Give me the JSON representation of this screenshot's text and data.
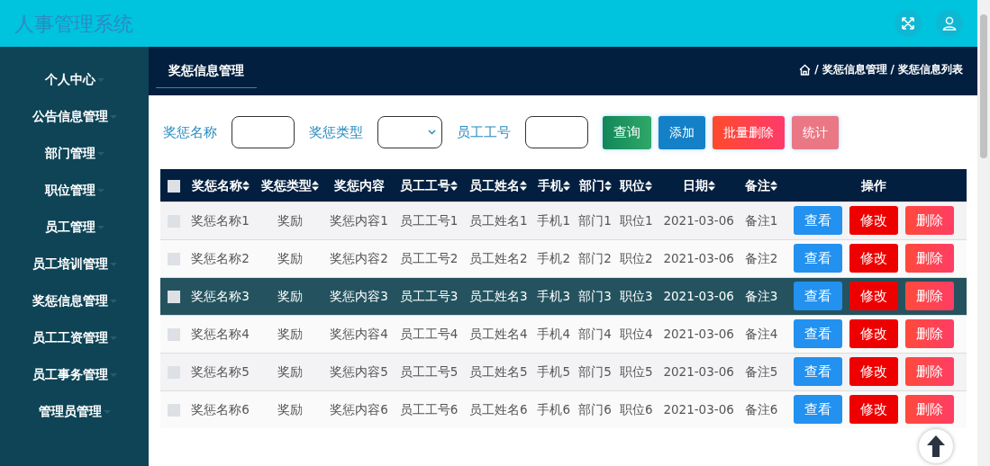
{
  "header": {
    "title": "人事管理系统"
  },
  "sidebar": {
    "items": [
      {
        "label": "个人中心"
      },
      {
        "label": "公告信息管理"
      },
      {
        "label": "部门管理"
      },
      {
        "label": "职位管理"
      },
      {
        "label": "员工管理"
      },
      {
        "label": "员工培训管理"
      },
      {
        "label": "奖惩信息管理"
      },
      {
        "label": "员工工资管理"
      },
      {
        "label": "员工事务管理"
      },
      {
        "label": "管理员管理"
      }
    ]
  },
  "page_tab": "奖惩信息管理",
  "breadcrumb": [
    {
      "separator": "/",
      "label": "奖惩信息管理"
    },
    {
      "separator": "/",
      "label": "奖惩信息列表"
    }
  ],
  "filters": [
    {
      "kind": "text",
      "label": "奖惩名称"
    },
    {
      "kind": "select",
      "label": "奖惩类型"
    },
    {
      "kind": "text",
      "label": "员工工号"
    }
  ],
  "actions": [
    {
      "kind": "search",
      "label": "查询"
    },
    {
      "kind": "add",
      "label": "添加"
    },
    {
      "kind": "delete",
      "label": "批量删除"
    },
    {
      "kind": "stats",
      "label": "统计"
    }
  ],
  "table": {
    "select_all": {
      "checked": false
    },
    "columns": [
      {
        "label": "奖惩名称",
        "sortable": true
      },
      {
        "label": "奖惩类型",
        "sortable": true
      },
      {
        "label": "奖惩内容",
        "sortable": false
      },
      {
        "label": "员工工号",
        "sortable": true
      },
      {
        "label": "员工姓名",
        "sortable": true
      },
      {
        "label": "手机",
        "sortable": true
      },
      {
        "label": "部门",
        "sortable": true
      },
      {
        "label": "职位",
        "sortable": true
      },
      {
        "label": "日期",
        "sortable": true
      },
      {
        "label": "备注",
        "sortable": true
      },
      {
        "label": "操作",
        "sortable": false
      }
    ],
    "rows": [
      {
        "selected": false,
        "checked": false,
        "cells": [
          "奖惩名称1",
          "奖励",
          "奖惩内容1",
          "员工工号1",
          "员工姓名1",
          "手机1",
          "部门1",
          "职位1",
          "2021-03-06",
          "备注1"
        ],
        "actions": [
          "查看",
          "修改",
          "删除"
        ]
      },
      {
        "selected": false,
        "checked": false,
        "cells": [
          "奖惩名称2",
          "奖励",
          "奖惩内容2",
          "员工工号2",
          "员工姓名2",
          "手机2",
          "部门2",
          "职位2",
          "2021-03-06",
          "备注2"
        ],
        "actions": [
          "查看",
          "修改",
          "删除"
        ]
      },
      {
        "selected": true,
        "checked": false,
        "cells": [
          "奖惩名称3",
          "奖励",
          "奖惩内容3",
          "员工工号3",
          "员工姓名3",
          "手机3",
          "部门3",
          "职位3",
          "2021-03-06",
          "备注3"
        ],
        "actions": [
          "查看",
          "修改",
          "删除"
        ]
      },
      {
        "selected": false,
        "checked": false,
        "cells": [
          "奖惩名称4",
          "奖励",
          "奖惩内容4",
          "员工工号4",
          "员工姓名4",
          "手机4",
          "部门4",
          "职位4",
          "2021-03-06",
          "备注4"
        ],
        "actions": [
          "查看",
          "修改",
          "删除"
        ]
      },
      {
        "selected": false,
        "checked": false,
        "cells": [
          "奖惩名称5",
          "奖励",
          "奖惩内容5",
          "员工工号5",
          "员工姓名5",
          "手机5",
          "部门5",
          "职位5",
          "2021-03-06",
          "备注5"
        ],
        "actions": [
          "查看",
          "修改",
          "删除"
        ]
      },
      {
        "selected": false,
        "checked": false,
        "cells": [
          "奖惩名称6",
          "奖励",
          "奖惩内容6",
          "员工工号6",
          "员工姓名6",
          "手机6",
          "部门6",
          "职位6",
          "2021-03-06",
          "备注6"
        ],
        "actions": [
          "查看",
          "修改",
          "删除"
        ]
      }
    ]
  }
}
